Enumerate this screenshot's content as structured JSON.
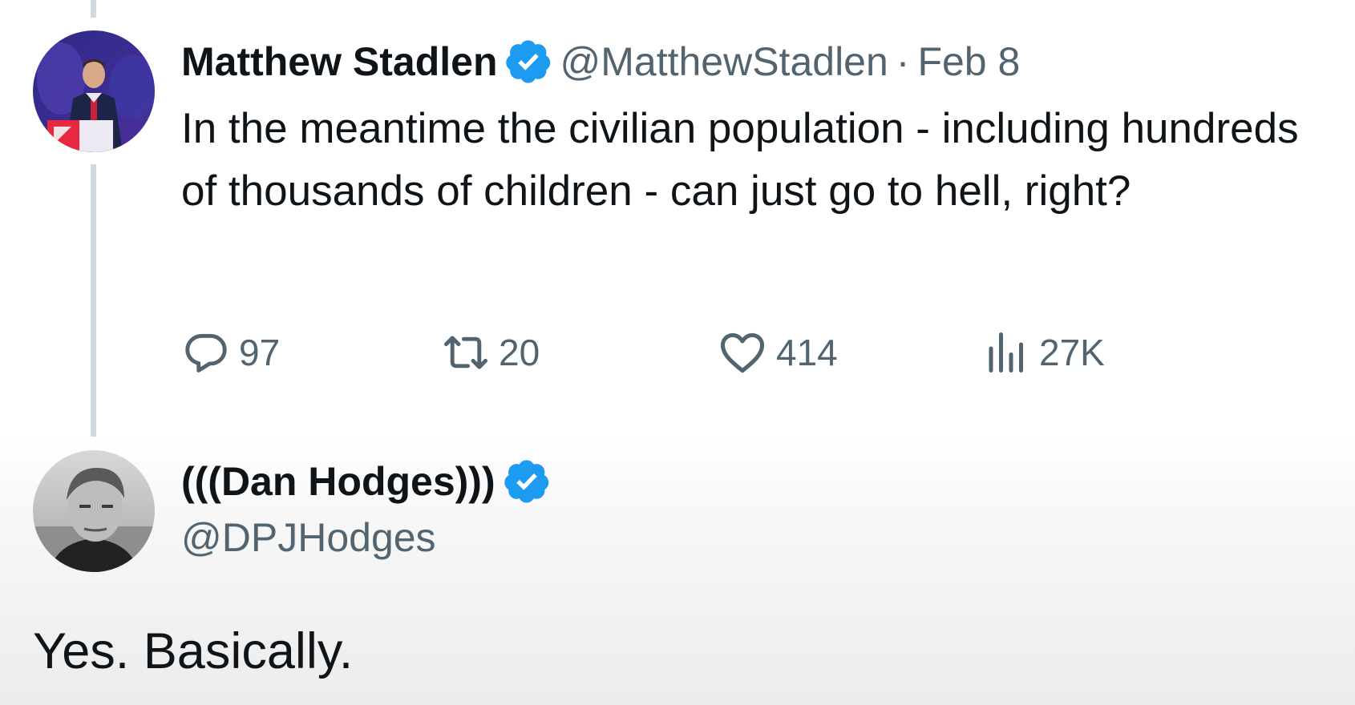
{
  "tweet": {
    "author_name": "Matthew Stadlen",
    "author_handle": "@MatthewStadlen",
    "separator": "·",
    "date": "Feb 8",
    "text": "In the meantime the civilian population - including hundreds of thousands of children - can just go to hell, right?",
    "replies": "97",
    "retweets": "20",
    "likes": "414",
    "views": "27K"
  },
  "reply": {
    "author_name": "(((Dan Hodges)))",
    "author_handle": "@DPJHodges",
    "text": "Yes. Basically."
  },
  "icons": {
    "verified": "verified-badge-icon",
    "reply": "reply-bubble-icon",
    "retweet": "retweet-icon",
    "like": "heart-icon",
    "views": "views-bar-chart-icon"
  },
  "colors": {
    "verified_blue": "#1d9bf0",
    "text_primary": "#0f1419",
    "text_secondary": "#536471",
    "thread_line": "#cfd9de"
  }
}
